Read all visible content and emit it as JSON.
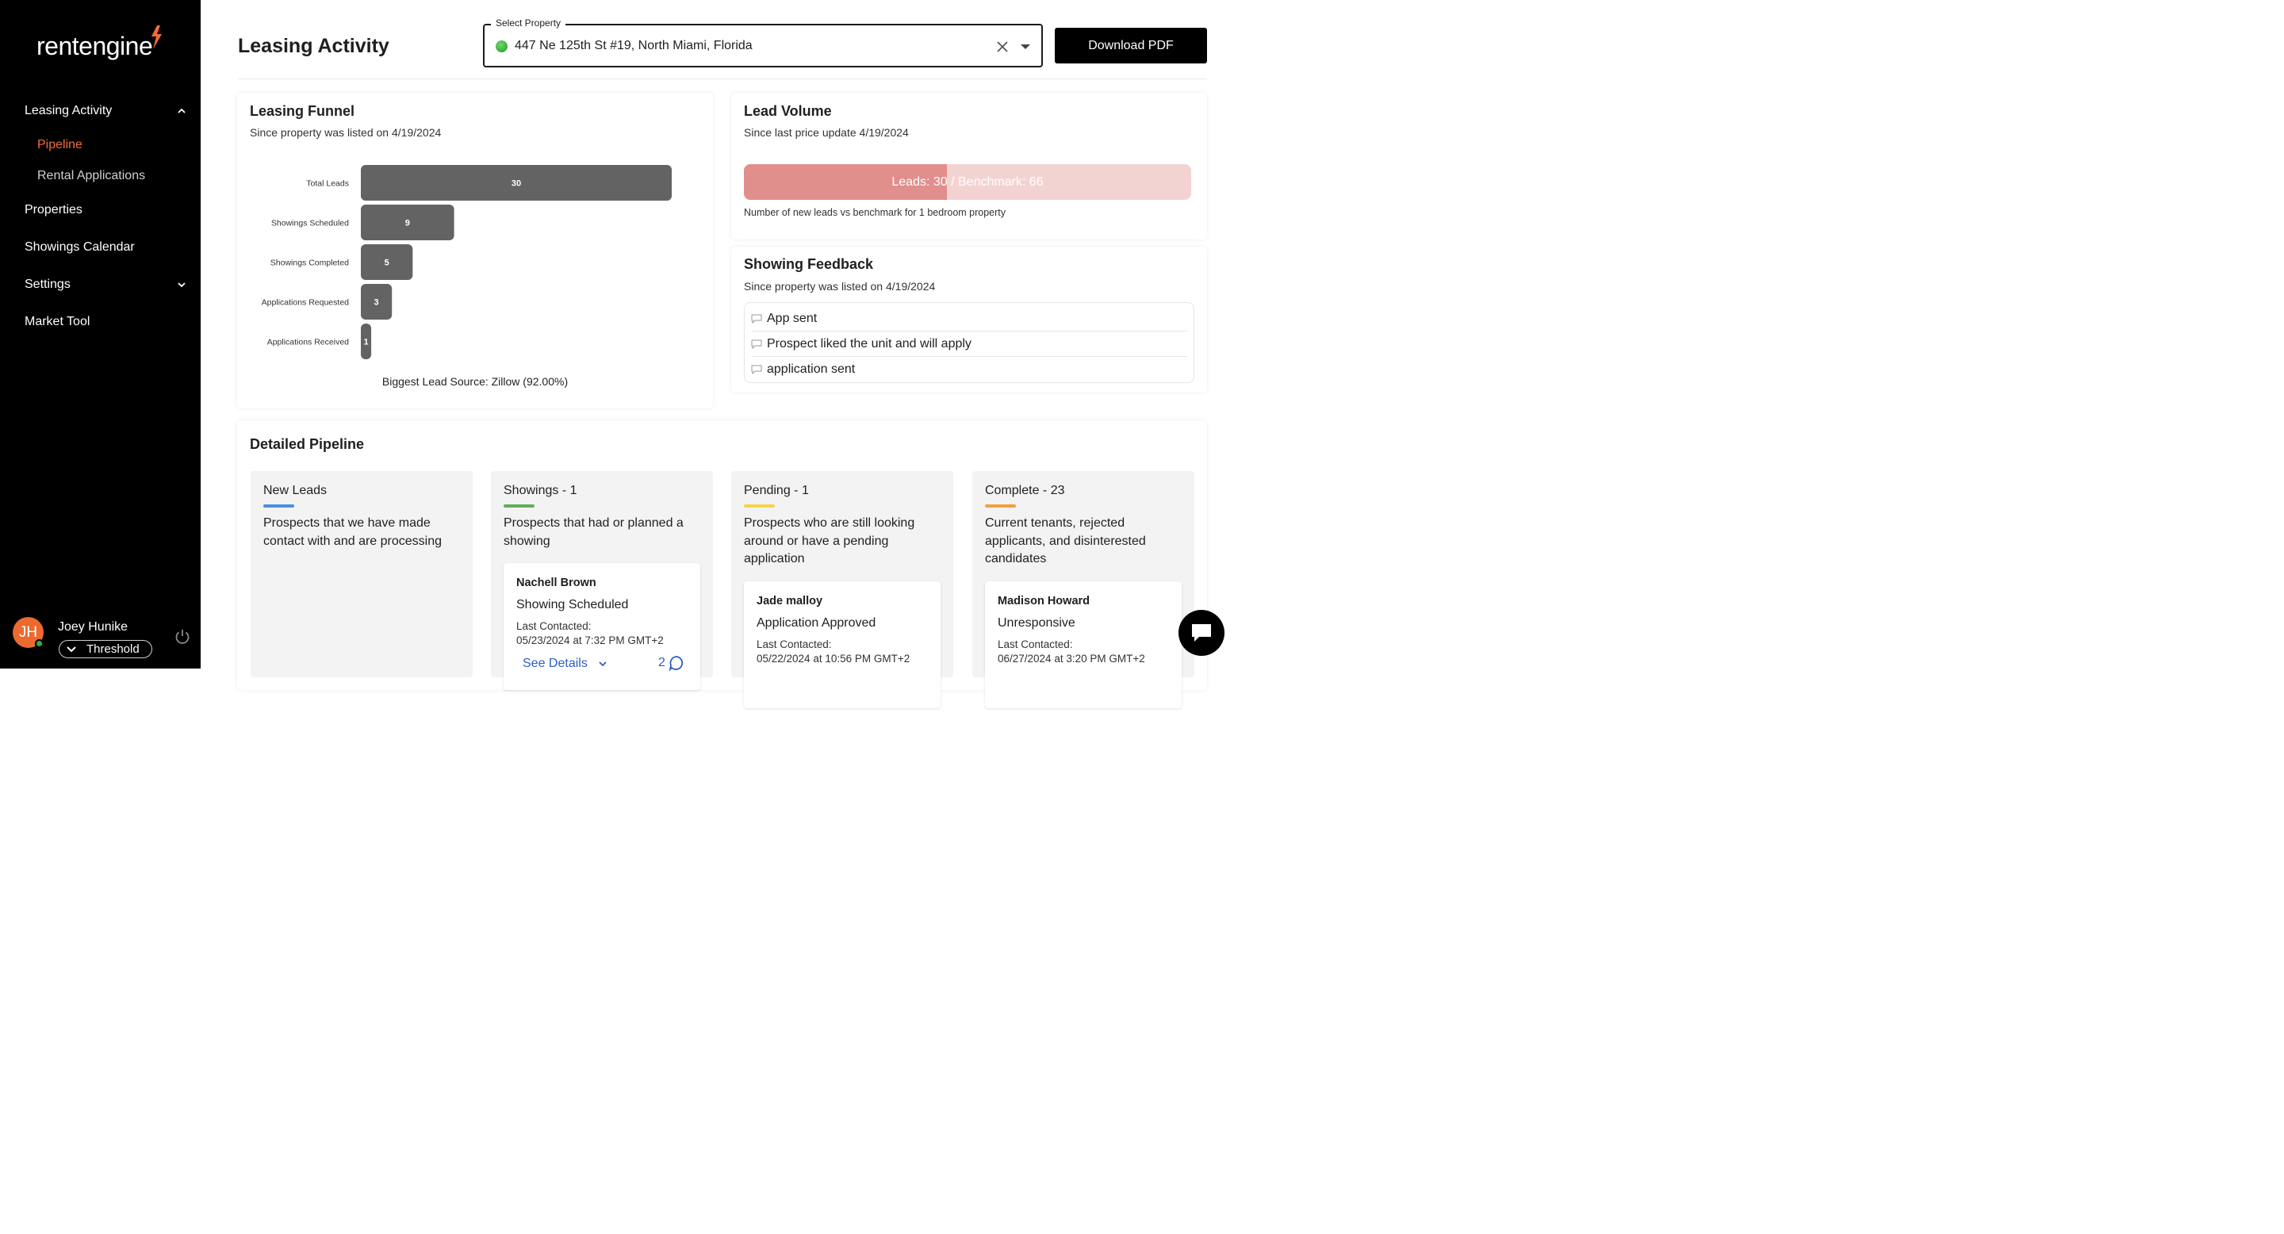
{
  "brand": {
    "logo_text": "rentengine",
    "accent": "#f26a3a"
  },
  "sidebar": {
    "items": [
      {
        "label": "Leasing Activity",
        "expanded": true
      },
      {
        "label": "Pipeline",
        "active": true
      },
      {
        "label": "Rental Applications"
      },
      {
        "label": "Properties"
      },
      {
        "label": "Showings Calendar"
      },
      {
        "label": "Settings",
        "expanded": false
      },
      {
        "label": "Market Tool"
      }
    ],
    "user": {
      "initials": "JH",
      "name": "Joey Hunike",
      "team": "Threshold",
      "online": true
    }
  },
  "header": {
    "title": "Leasing Activity",
    "select_label": "Select Property",
    "select_value": "447 Ne 125th St #19, North Miami, Florida",
    "download_label": "Download PDF"
  },
  "funnel": {
    "title": "Leasing Funnel",
    "subtitle": "Since property was listed on 4/19/2024",
    "lead_source": "Biggest Lead Source: Zillow (92.00%)"
  },
  "chart_data": {
    "type": "bar",
    "orientation": "horizontal",
    "categories": [
      "Total Leads",
      "Showings Scheduled",
      "Showings Completed",
      "Applications Requested",
      "Applications Received"
    ],
    "values": [
      30,
      9,
      5,
      3,
      1
    ],
    "bar_color": "#636363"
  },
  "lead_volume": {
    "title": "Lead Volume",
    "subtitle": "Since last price update 4/19/2024",
    "leads": 30,
    "benchmark": 66,
    "bar_text": "Leads: 30 / Benchmark: 66",
    "note": "Number of new leads vs benchmark for 1 bedroom property"
  },
  "feedback": {
    "title": "Showing Feedback",
    "subtitle": "Since property was listed on 4/19/2024",
    "items": [
      "App sent",
      "Prospect liked the unit and will apply",
      "application sent"
    ]
  },
  "pipeline": {
    "title": "Detailed Pipeline",
    "columns": [
      {
        "title": "New Leads",
        "color": "#4a8fe2",
        "desc": "Prospects that we have made contact with and are processing"
      },
      {
        "title": "Showings - 1",
        "color": "#5fae5a",
        "desc": "Prospects that had or planned a showing",
        "card": {
          "name": "Nachell Brown",
          "status": "Showing Scheduled",
          "label": "Last Contacted:",
          "date": "05/23/2024 at 7:32 PM GMT+2",
          "details": "See Details",
          "count": "2"
        }
      },
      {
        "title": "Pending - 1",
        "color": "#f2d64b",
        "desc": "Prospects who are still looking around or have a pending application",
        "card": {
          "name": "Jade malloy",
          "status": "Application Approved",
          "label": "Last Contacted:",
          "date": "05/22/2024 at 10:56 PM GMT+2"
        }
      },
      {
        "title": "Complete - 23",
        "color": "#f0a040",
        "desc": "Current tenants, rejected applicants, and disinterested candidates",
        "card": {
          "name": "Madison Howard",
          "status": "Unresponsive",
          "label": "Last Contacted:",
          "date": "06/27/2024 at 3:20 PM GMT+2"
        }
      }
    ]
  }
}
